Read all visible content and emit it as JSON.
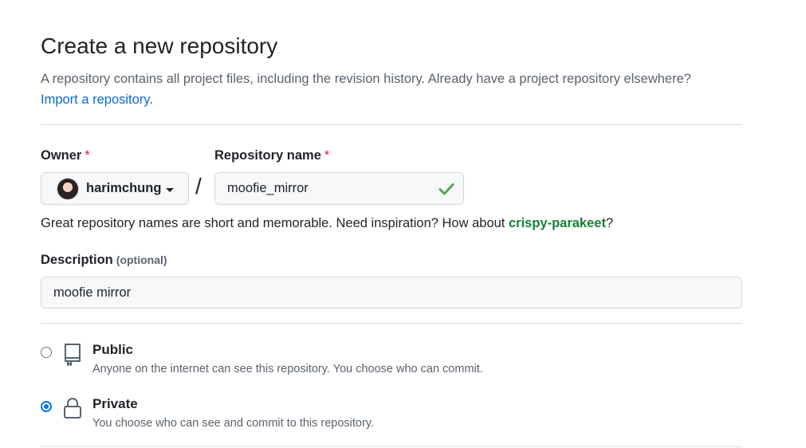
{
  "header": {
    "title": "Create a new repository",
    "subtitle": "A repository contains all project files, including the revision history. Already have a project repository elsewhere?",
    "import_link": "Import a repository."
  },
  "owner": {
    "label": "Owner",
    "required_mark": "*",
    "value": "harimchung"
  },
  "separator": "/",
  "repo_name": {
    "label": "Repository name",
    "required_mark": "*",
    "value": "moofie_mirror"
  },
  "hint": {
    "text": "Great repository names are short and memorable. Need inspiration? How about ",
    "suggestion": "crispy-parakeet",
    "suffix": "?"
  },
  "description": {
    "label": "Description",
    "optional_label": "(optional)",
    "value": "moofie mirror"
  },
  "visibility": {
    "public": {
      "title": "Public",
      "description": "Anyone on the internet can see this repository. You choose who can commit.",
      "selected": false
    },
    "private": {
      "title": "Private",
      "description": "You choose who can see and commit to this repository.",
      "selected": true
    }
  },
  "colors": {
    "link": "#0969da",
    "success": "#1a7f37",
    "required": "#d1242f",
    "radio_checked": "#0075ff"
  }
}
